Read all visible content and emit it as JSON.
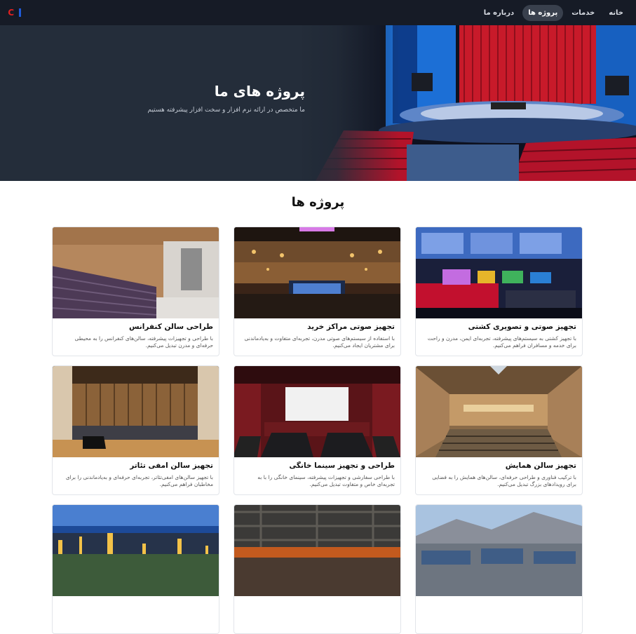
{
  "navbar": {
    "logo_alt": "I&C",
    "links": [
      {
        "label": "خانه",
        "active": false
      },
      {
        "label": "خدمات",
        "active": false
      },
      {
        "label": "پروژه ها",
        "active": true
      },
      {
        "label": "درباره ما",
        "active": false
      }
    ]
  },
  "hero": {
    "title": "پروژه های ما",
    "subtitle": "ما متخصص در ارائه نرم افزار و سخت افزار پیشرفته هستیم"
  },
  "projects_section": {
    "title": "پروژه ها",
    "cards": [
      {
        "title": "تجهیز صوتی و تصویری کشتی",
        "text": "با تجهیز کشتی به سیستم‌های پیشرفته، تجربه‌ای ایمن، مدرن و راحت برای خدمه و مسافران فراهم می‌کنیم.",
        "image_icon": "ship-bridge-image"
      },
      {
        "title": "تجهیز صوتی مراکز خرید",
        "text": "با استفاده از سیستم‌های صوتی مدرن، تجربه‌ای متفاوت و به‌یادماندنی برای مشتریان ایجاد می‌کنیم.",
        "image_icon": "mall-atrium-image"
      },
      {
        "title": "طراحی سالن کنفرانس",
        "text": "با طراحی و تجهیزات پیشرفته، سالن‌های کنفرانس را به محیطی حرفه‌ای و مدرن تبدیل می‌کنیم.",
        "image_icon": "conference-hall-image"
      },
      {
        "title": "تجهیز سالن همایش",
        "text": "با ترکیب فناوری و طراحی حرفه‌ای، سالن‌های همایش را به فضایی برای رویدادهای بزرگ تبدیل می‌کنیم.",
        "image_icon": "auditorium-image"
      },
      {
        "title": "طراحی و تجهیز سینما خانگی",
        "text": "با طراحی سفارشی و تجهیزات پیشرفته، سینمای خانگی را با به تجربه‌ای خاص و متفاوت تبدیل می‌کنیم.",
        "image_icon": "home-cinema-image"
      },
      {
        "title": "تجهیز سالن امفی تئاتر",
        "text": "با تجهیز سالن‌های امفی‌تئاتر، تجربه‌ای حرفه‌ای و به‌یادماندنی را برای مخاطبان فراهم می‌کنیم.",
        "image_icon": "amphitheater-image"
      },
      {
        "title": "",
        "text": "",
        "image_icon": "industrial-site-image"
      },
      {
        "title": "",
        "text": "",
        "image_icon": "steel-factory-image"
      },
      {
        "title": "",
        "text": "",
        "image_icon": "refinery-night-image"
      }
    ]
  },
  "colors": {
    "navbar_bg": "#161b26",
    "hero_bg": "#242d3a",
    "curtain_red": "#c81a2a",
    "seat_red": "#b3132a",
    "stage_blue": "#1c6fd6"
  }
}
